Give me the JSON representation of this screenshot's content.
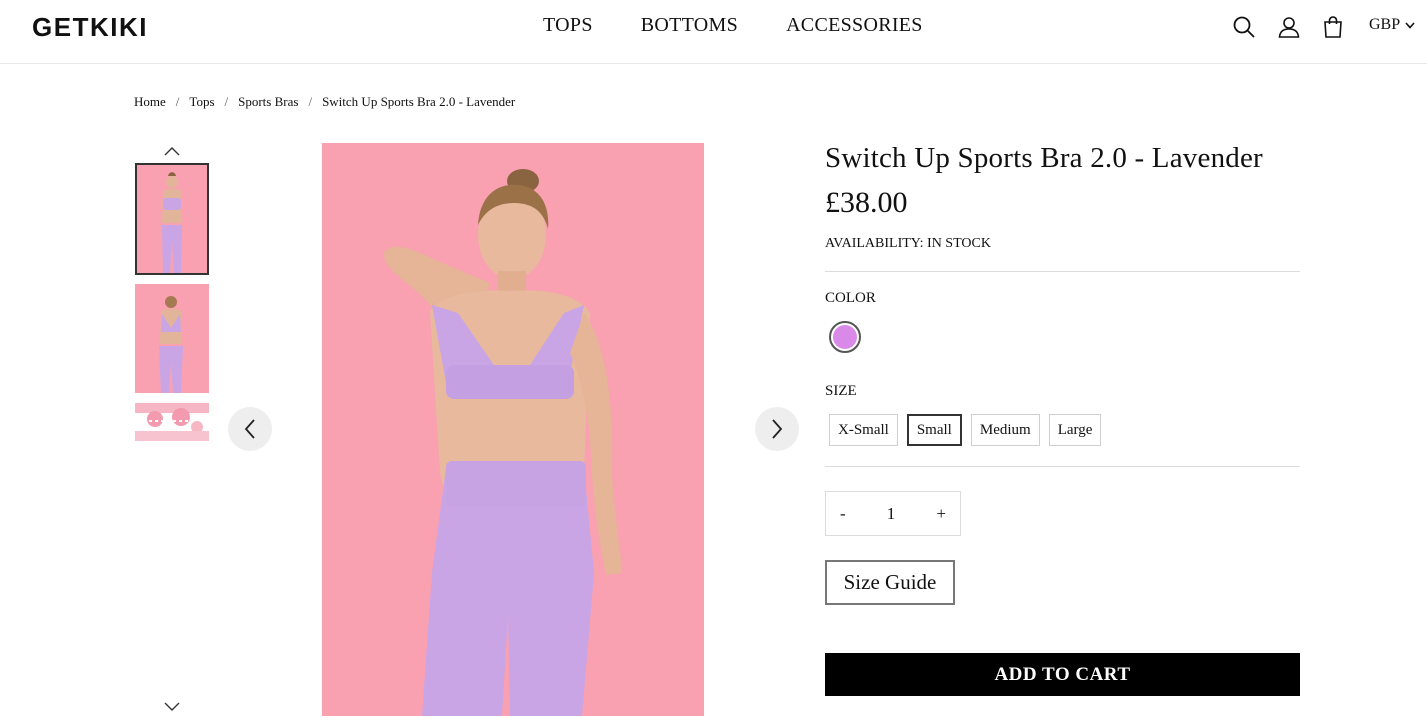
{
  "header": {
    "logo": "GETKIKI",
    "nav": [
      "TOPS",
      "BOTTOMS",
      "ACCESSORIES"
    ],
    "icons": [
      "search-icon",
      "account-icon",
      "cart-icon"
    ],
    "currency": "GBP"
  },
  "breadcrumb": [
    "Home",
    "Tops",
    "Sports Bras",
    "Switch Up Sports Bra 2.0 - Lavender"
  ],
  "product": {
    "title": "Switch Up Sports Bra 2.0 - Lavender",
    "price": "£38.00",
    "availability": "AVAILABILITY: IN STOCK",
    "color_label": "COLOR",
    "selected_color": "#d98ae8",
    "size_label": "SIZE",
    "sizes": [
      "X-Small",
      "Small",
      "Medium",
      "Large"
    ],
    "selected_size": "Small",
    "quantity": "1",
    "qty_minus": "-",
    "qty_plus": "+",
    "size_guide": "Size Guide",
    "add_to_cart": "ADD TO CART"
  },
  "colors": {
    "image_background": "#f9a1b1",
    "garment": "#c9a5e6",
    "button": "#000000"
  }
}
